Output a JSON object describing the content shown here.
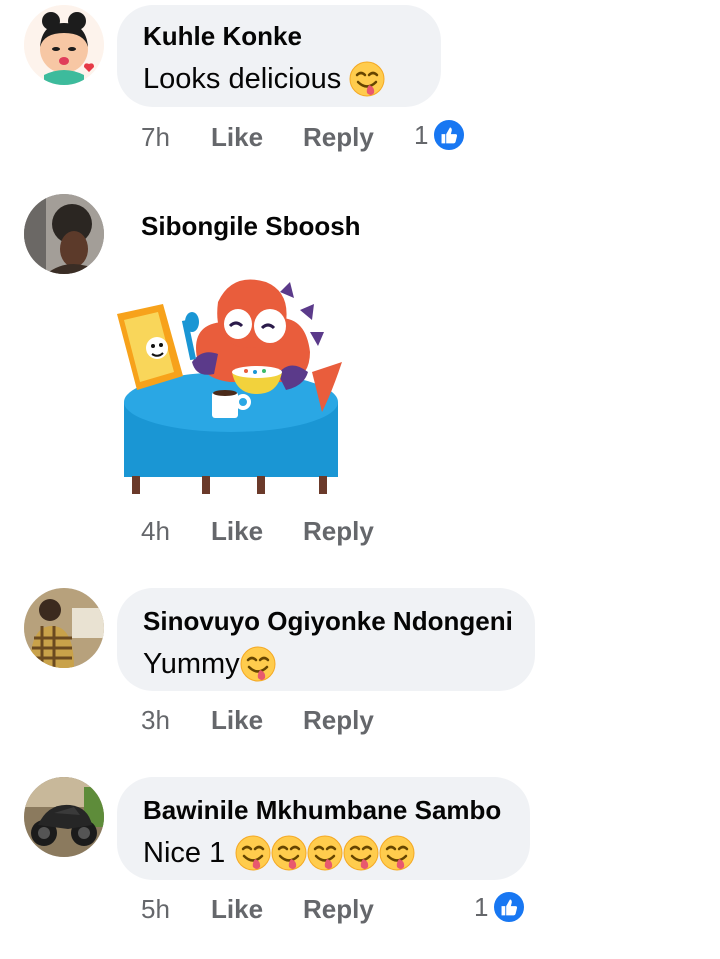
{
  "comments": [
    {
      "author": "Kuhle Konke",
      "text": "Looks delicious",
      "emoji": "yum-emoji",
      "time": "7h",
      "like_label": "Like",
      "reply_label": "Reply",
      "reaction_count": "1",
      "reaction_icon": "like-thumb-icon"
    },
    {
      "author": "Sibongile Sboosh",
      "sticker": "dinosaur-eating-breakfast-sticker",
      "time": "4h",
      "like_label": "Like",
      "reply_label": "Reply"
    },
    {
      "author": "Sinovuyo Ogiyonke Ndongeni",
      "text": "Yummy",
      "emoji": "yum-emoji",
      "time": "3h",
      "like_label": "Like",
      "reply_label": "Reply"
    },
    {
      "author": "Bawinile Mkhumbane Sambo",
      "text": "Nice 1",
      "emoji_count": 5,
      "emoji": "yum-emoji",
      "time": "5h",
      "like_label": "Like",
      "reply_label": "Reply",
      "reaction_count": "1",
      "reaction_icon": "like-thumb-icon"
    }
  ],
  "colors": {
    "bubble": "#f0f2f5",
    "meta_text": "#65676b",
    "like_blue": "#1877f2"
  }
}
